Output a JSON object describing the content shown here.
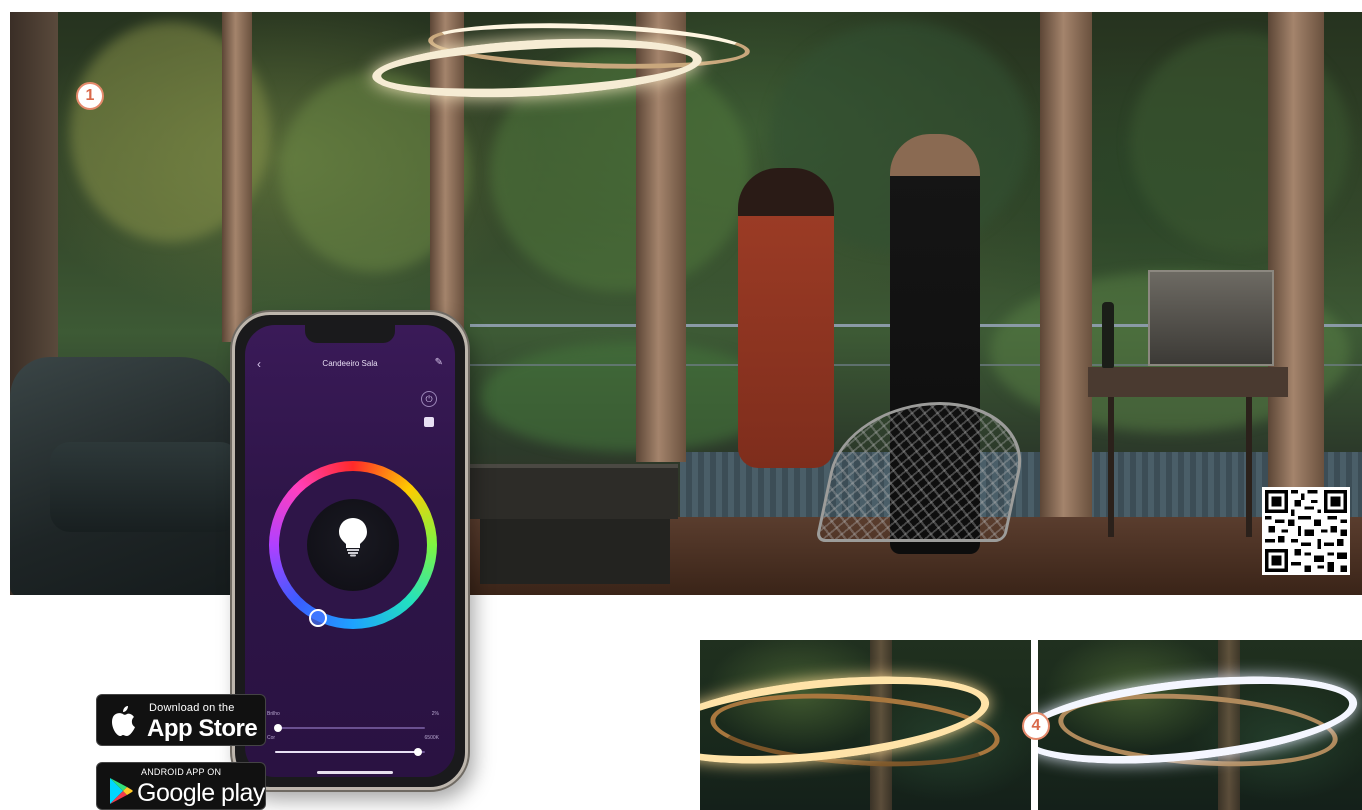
{
  "hero": {
    "callout_number": "1"
  },
  "phone": {
    "device_title": "Candeeiro Sala",
    "sliders": [
      {
        "label": "Brilho",
        "value_text": "2%",
        "level": 0.02
      },
      {
        "label": "Cor",
        "value_text": "6500K",
        "level": 0.95
      }
    ]
  },
  "badges": {
    "appstore": {
      "small": "Download on the",
      "big": "App Store"
    },
    "google": {
      "small": "ANDROID APP ON",
      "big": "Google play"
    }
  },
  "thumbnails": {
    "callout_number": "4"
  },
  "colors": {
    "callout_border": "#e58a6c",
    "callout_text": "#d9694a",
    "screen_bg": "#2e1548"
  }
}
